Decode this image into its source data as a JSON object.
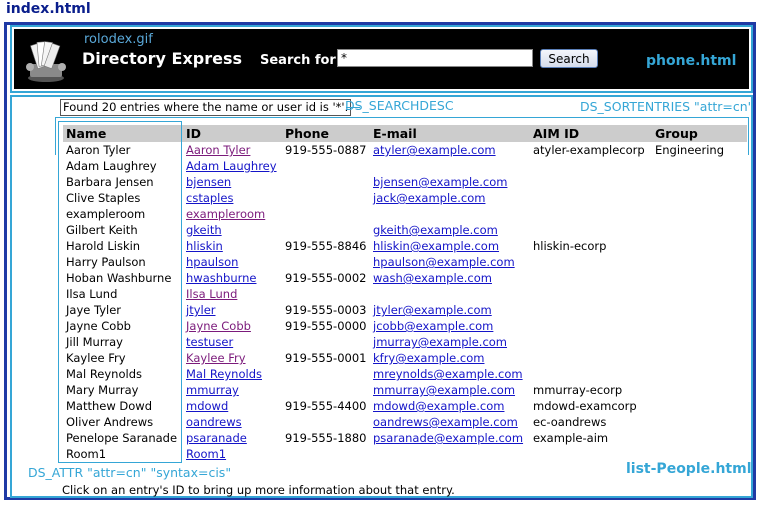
{
  "page_label": "index.html",
  "header": {
    "logo_caption": "rolodex.gif",
    "app_title": "Directory Express",
    "search_label": "Search for:",
    "search_value": "*",
    "search_button": "Search",
    "annotation": "phone.html"
  },
  "status": {
    "found_text": "Found 20 entries where the name or user id is '*'.",
    "found_annotation": "DS_SEARCHDESC",
    "sort_annotation": "DS_SORTENTRIES \"attr=cn\"",
    "attr_annotation": "DS_ATTR \"attr=cn\" \"syntax=cis\"",
    "list_annotation": "list-People.html"
  },
  "table": {
    "columns": [
      "Name",
      "ID",
      "Phone",
      "E-mail",
      "AIM ID",
      "Group"
    ],
    "rows": [
      {
        "name": "Aaron Tyler",
        "id": "Aaron Tyler",
        "phone": "919-555-0887",
        "email": "atyler@example.com",
        "aim": "atyler-examplecorp",
        "group": "Engineering"
      },
      {
        "name": "Adam Laughrey",
        "id": "Adam Laughrey",
        "phone": "",
        "email": "",
        "aim": "",
        "group": ""
      },
      {
        "name": "Barbara Jensen",
        "id": "bjensen",
        "phone": "",
        "email": "bjensen@example.com",
        "aim": "",
        "group": ""
      },
      {
        "name": "Clive Staples",
        "id": "cstaples",
        "phone": "",
        "email": "jack@example.com",
        "aim": "",
        "group": ""
      },
      {
        "name": "exampleroom",
        "id": "exampleroom",
        "phone": "",
        "email": "",
        "aim": "",
        "group": ""
      },
      {
        "name": "Gilbert Keith",
        "id": "gkeith",
        "phone": "",
        "email": "gkeith@example.com",
        "aim": "",
        "group": ""
      },
      {
        "name": "Harold Liskin",
        "id": "hliskin",
        "phone": "919-555-8846",
        "email": "hliskin@example.com",
        "aim": "hliskin-ecorp",
        "group": ""
      },
      {
        "name": "Harry Paulson",
        "id": "hpaulson",
        "phone": "",
        "email": "hpaulson@example.com",
        "aim": "",
        "group": ""
      },
      {
        "name": "Hoban Washburne",
        "id": "hwashburne",
        "phone": "919-555-0002",
        "email": "wash@example.com",
        "aim": "",
        "group": ""
      },
      {
        "name": "Ilsa Lund",
        "id": "Ilsa Lund",
        "phone": "",
        "email": "",
        "aim": "",
        "group": ""
      },
      {
        "name": "Jaye Tyler",
        "id": "jtyler",
        "phone": "919-555-0003",
        "email": "jtyler@example.com",
        "aim": "",
        "group": ""
      },
      {
        "name": "Jayne Cobb",
        "id": "Jayne Cobb",
        "phone": "919-555-0000",
        "email": "jcobb@example.com",
        "aim": "",
        "group": ""
      },
      {
        "name": "Jill Murray",
        "id": "testuser",
        "phone": "",
        "email": "jmurray@example.com",
        "aim": "",
        "group": ""
      },
      {
        "name": "Kaylee Fry",
        "id": "Kaylee Fry",
        "phone": "919-555-0001",
        "email": "kfry@example.com",
        "aim": "",
        "group": ""
      },
      {
        "name": "Mal Reynolds",
        "id": "Mal Reynolds",
        "phone": "",
        "email": "mreynolds@example.com",
        "aim": "",
        "group": ""
      },
      {
        "name": "Mary Murray",
        "id": "mmurray",
        "phone": "",
        "email": "mmurray@example.com",
        "aim": "mmurray-ecorp",
        "group": ""
      },
      {
        "name": "Matthew Dowd",
        "id": "mdowd",
        "phone": "919-555-4400",
        "email": "mdowd@example.com",
        "aim": "mdowd-examcorp",
        "group": ""
      },
      {
        "name": "Oliver Andrews",
        "id": "oandrews",
        "phone": "",
        "email": "oandrews@example.com",
        "aim": "ec-oandrews",
        "group": ""
      },
      {
        "name": "Penelope Saranade",
        "id": "psaranade",
        "phone": "919-555-1880",
        "email": "psaranade@example.com",
        "aim": "example-aim",
        "group": ""
      },
      {
        "name": "Room1",
        "id": "Room1",
        "phone": "",
        "email": "",
        "aim": "",
        "group": ""
      }
    ]
  },
  "footer": "Click on an entry's ID to bring up more information about that entry.",
  "colors": {
    "accent": "#35a6d6",
    "frame": "#1f3aa5",
    "header_bg": "#000000",
    "link": "#1414c8",
    "visited_link": "#7b1a7b"
  },
  "icons": {
    "logo": "rolodex-icon"
  }
}
